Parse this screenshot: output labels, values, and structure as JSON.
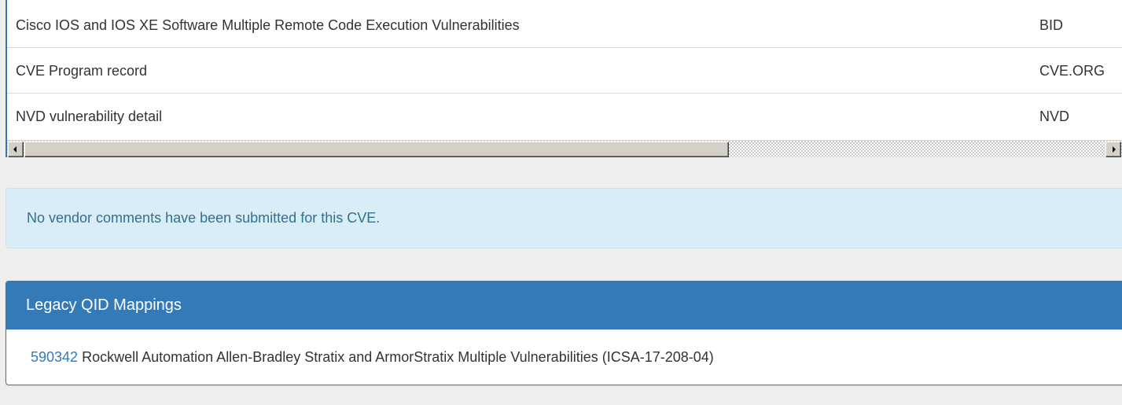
{
  "references": {
    "rows": [
      {
        "title": "Cisco IOS and IOS XE Software Multiple Remote Code Execution Vulnerabilities",
        "source": "BID"
      },
      {
        "title": "CVE Program record",
        "source": "CVE.ORG"
      },
      {
        "title": "NVD vulnerability detail",
        "source": "NVD"
      }
    ]
  },
  "vendor_comments": {
    "message": "No vendor comments have been submitted for this CVE."
  },
  "legacy_qid": {
    "heading": "Legacy QID Mappings",
    "items": [
      {
        "qid": "590342",
        "description": "Rockwell Automation Allen-Bradley Stratix and ArmorStratix Multiple Vulnerabilities (ICSA-17-208-04)"
      }
    ]
  },
  "colors": {
    "panel_primary": "#337ab7",
    "alert_info_bg": "#d9edf7",
    "alert_info_text": "#31708f",
    "link": "#337ab7"
  }
}
